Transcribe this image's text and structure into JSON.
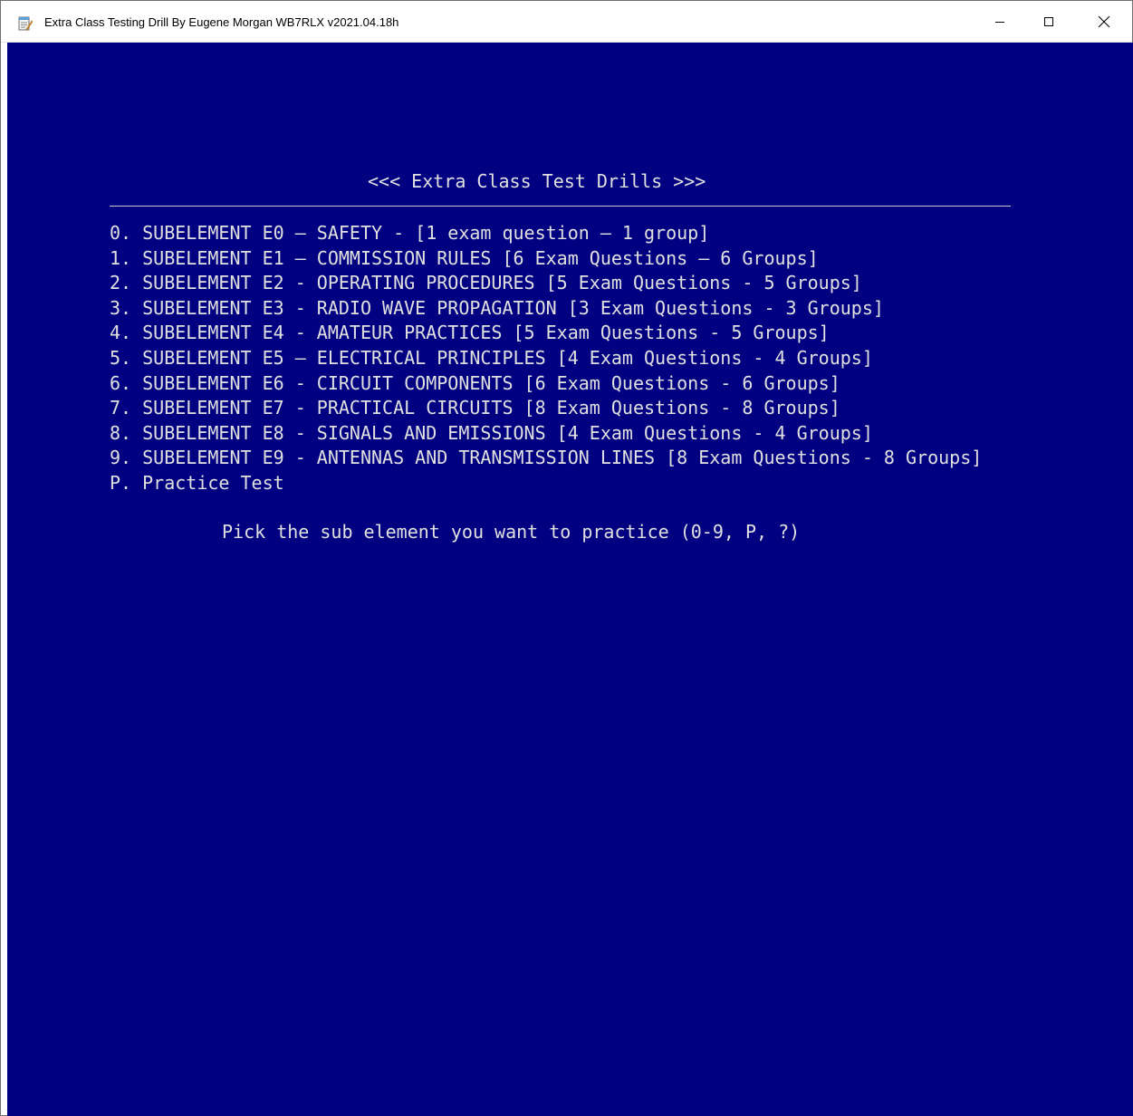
{
  "window": {
    "title": "Extra Class Testing Drill By Eugene Morgan WB7RLX v2021.04.18h",
    "icon": "notepad-app-icon",
    "controls": {
      "minimize_icon": "minimize-icon",
      "maximize_icon": "maximize-icon",
      "close_icon": "close-icon"
    }
  },
  "console": {
    "background": "#000080",
    "foreground": "#e0e0e0",
    "heading": "<<< Extra Class Test Drills >>>",
    "menu_items": [
      "0. SUBELEMENT E0 – SAFETY - [1 exam question – 1 group]",
      "1. SUBELEMENT E1 — COMMISSION RULES [6 Exam Questions — 6 Groups]",
      "2. SUBELEMENT E2 - OPERATING PROCEDURES [5 Exam Questions - 5 Groups]",
      "3. SUBELEMENT E3 - RADIO WAVE PROPAGATION [3 Exam Questions - 3 Groups]",
      "4. SUBELEMENT E4 - AMATEUR PRACTICES [5 Exam Questions - 5 Groups]",
      "5. SUBELEMENT E5 – ELECTRICAL PRINCIPLES [4 Exam Questions - 4 Groups]",
      "6. SUBELEMENT E6 - CIRCUIT COMPONENTS [6 Exam Questions - 6 Groups]",
      "7. SUBELEMENT E7 - PRACTICAL CIRCUITS [8 Exam Questions - 8 Groups]",
      "8. SUBELEMENT E8 - SIGNALS AND EMISSIONS [4 Exam Questions - 4 Groups]",
      "9. SUBELEMENT E9 - ANTENNAS AND TRANSMISSION LINES [8 Exam Questions - 8 Groups]",
      "P. Practice Test"
    ],
    "prompt": "Pick the sub element you want to practice (0-9, P, ?)"
  }
}
